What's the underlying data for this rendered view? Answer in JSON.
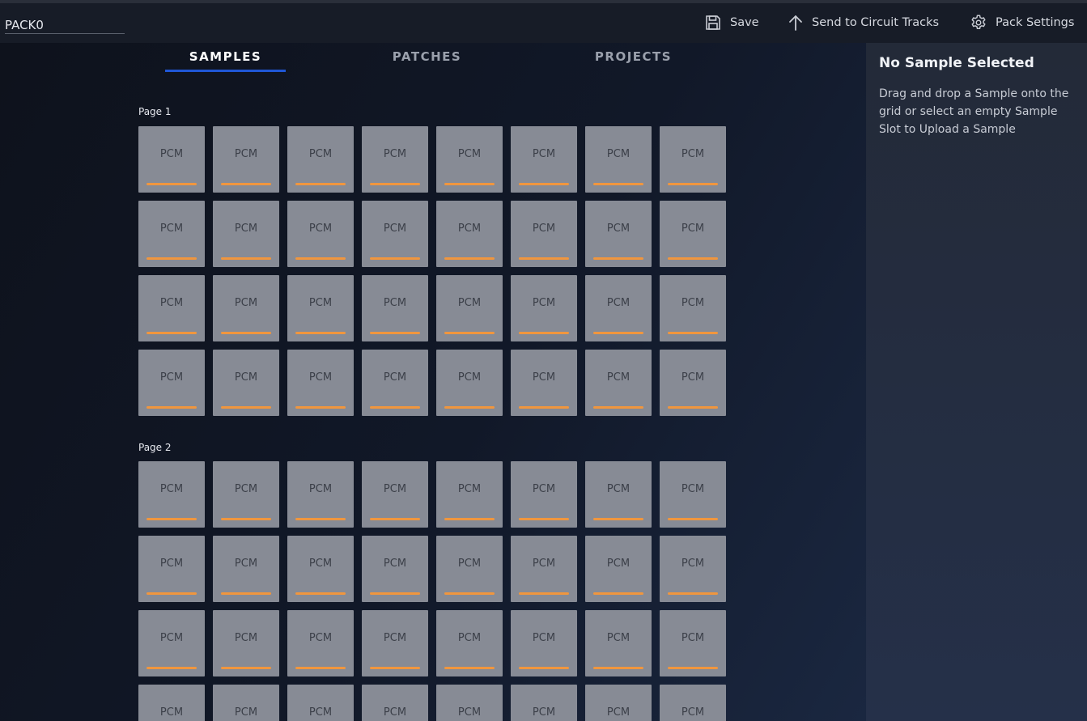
{
  "toolbar": {
    "pack_name": "PACK0",
    "save_label": "Save",
    "send_label": "Send to Circuit Tracks",
    "settings_label": "Pack Settings"
  },
  "tabs": [
    {
      "label": "SAMPLES",
      "active": true
    },
    {
      "label": "PATCHES",
      "active": false
    },
    {
      "label": "PROJECTS",
      "active": false
    }
  ],
  "pages": [
    {
      "label": "Page 1",
      "slot_label": "PCM",
      "slot_count": 32
    },
    {
      "label": "Page 2",
      "slot_label": "PCM",
      "slot_count": 32
    }
  ],
  "side_panel": {
    "title": "No Sample Selected",
    "description": "Drag and drop a Sample onto the grid or select an empty Sample Slot to Upload a Sample"
  },
  "colors": {
    "accent_tab": "#1f57d6",
    "slot_bar": "#f0963e",
    "slot_bg": "#878b95"
  },
  "icons": {
    "save": "save-icon",
    "send": "upload-arrow-icon",
    "settings": "gear-icon"
  }
}
